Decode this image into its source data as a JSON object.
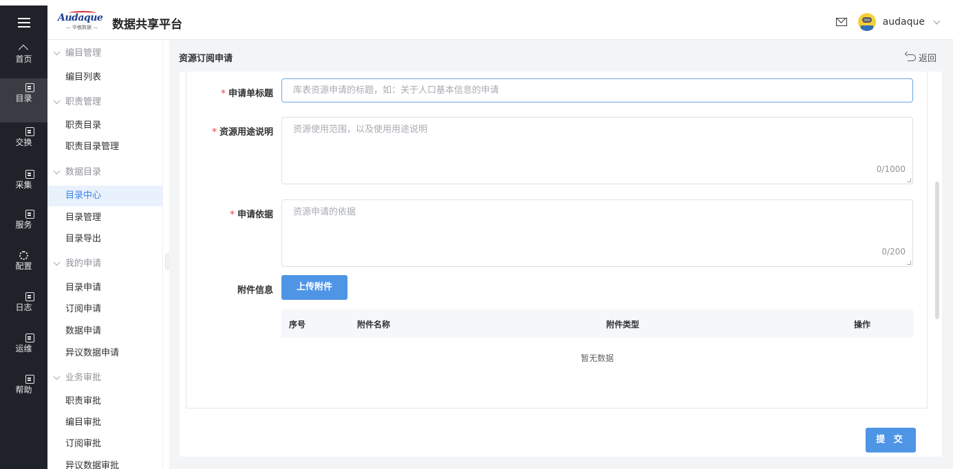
{
  "header": {
    "logo_brand": "Audaque",
    "logo_sub": "— 华傲数据 —",
    "app_title": "数据共享平台",
    "username": "audaque"
  },
  "rail": [
    {
      "label": "首页",
      "icon": "home-icon"
    },
    {
      "label": "目录",
      "icon": "catalog-icon",
      "active": true
    },
    {
      "label": "交换",
      "icon": "exchange-icon"
    },
    {
      "label": "采集",
      "icon": "collect-icon"
    },
    {
      "label": "服务",
      "icon": "service-icon"
    },
    {
      "label": "配置",
      "icon": "gear-icon"
    },
    {
      "label": "日志",
      "icon": "log-icon"
    },
    {
      "label": "运维",
      "icon": "ops-icon"
    },
    {
      "label": "帮助",
      "icon": "help-icon"
    }
  ],
  "menu": {
    "g1": "编目管理",
    "g1_items": [
      "编目列表"
    ],
    "g2": "职责管理",
    "g2_items": [
      "职责目录",
      "职责目录管理"
    ],
    "g3": "数据目录",
    "g3_items": [
      "目录中心",
      "目录管理",
      "目录导出"
    ],
    "g4": "我的申请",
    "g4_items": [
      "目录申请",
      "订阅申请",
      "数据申请",
      "异议数据申请"
    ],
    "g5": "业务审批",
    "g5_items": [
      "职责审批",
      "编目审批",
      "订阅审批",
      "异议数据审批"
    ]
  },
  "page": {
    "title": "资源订阅申请",
    "back": "返回"
  },
  "form": {
    "title_label": "申请单标题",
    "title_placeholder": "库表资源申请的标题，如：关于人口基本信息的申请",
    "usage_label": "资源用途说明",
    "usage_placeholder": "资源使用范围，以及使用用途说明",
    "usage_counter": "0/1000",
    "basis_label": "申请依据",
    "basis_placeholder": "资源申请的依据",
    "basis_counter": "0/200",
    "attach_label": "附件信息",
    "upload_btn": "上传附件",
    "table_headers": [
      "序号",
      "附件名称",
      "附件类型",
      "操作"
    ],
    "empty_text": "暂无数据",
    "submit": "提 交"
  },
  "colors": {
    "rail_bg": "#20222a",
    "primary": "#4e95e6",
    "active_menu_bg": "#e9f1fd",
    "required": "#f56c6c"
  }
}
